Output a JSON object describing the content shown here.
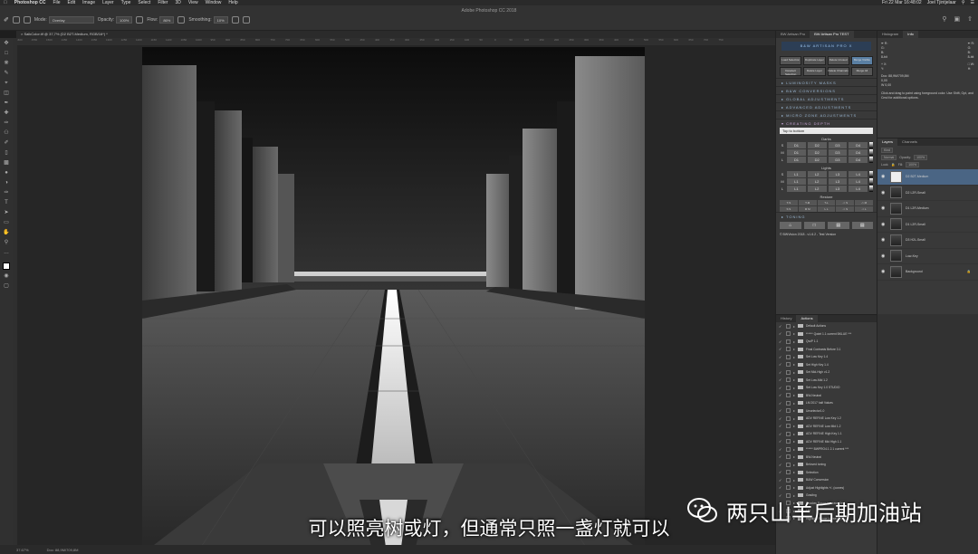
{
  "menubar": {
    "app": "Photoshop CC",
    "menus": [
      "File",
      "Edit",
      "Image",
      "Layer",
      "Type",
      "Select",
      "Filter",
      "3D",
      "View",
      "Window",
      "Help"
    ],
    "clock": "Fri 22 Mar  16:48:02",
    "user": "Joel Tjintjelaar"
  },
  "options": {
    "window_title": "Adobe Photoshop CC 2018",
    "mode_label": "Mode:",
    "mode_value": "Overlay",
    "opacity_label": "Opacity:",
    "opacity_value": "100%",
    "flow_label": "Flow:",
    "flow_value": "86%",
    "smoothing_label": "Smoothing:",
    "smoothing_value": "10%"
  },
  "document_tab": "SalkColor.tif @ 37,7% (D2 B2T-Medium, RGB/16*) *",
  "ruler_marks": [
    "1600",
    "1550",
    "1500",
    "1450",
    "1400",
    "1350",
    "1300",
    "1250",
    "1200",
    "1150",
    "1100",
    "1050",
    "1000",
    "950",
    "900",
    "850",
    "800",
    "750",
    "700",
    "650",
    "600",
    "550",
    "500",
    "450",
    "400",
    "350",
    "300",
    "250",
    "200",
    "150",
    "100",
    "50",
    "0",
    "50",
    "100",
    "150",
    "200",
    "250",
    "300",
    "350",
    "400",
    "450",
    "500",
    "550",
    "600",
    "650",
    "700",
    "750"
  ],
  "status": {
    "zoom": "37.67%",
    "doc": "Doc: 88,9M/709,8M"
  },
  "ba_panel": {
    "tab1": "BW Artisan Pro",
    "tab2": "BW Artisan Pro TEST",
    "logo": "B&W ARTISAN PRO X",
    "buttons": [
      "Load Selection",
      "Duplicate Layer",
      "Delete Unused",
      "Merge Visible",
      "Deselect Selection",
      "Delete Layer",
      "Delete Channels",
      "Merge All"
    ],
    "sections": [
      "LUMINOSITY MASKS",
      "B&W CONVERSIONS",
      "GLOBAL ADJUSTMENTS",
      "ADVANCED ADJUSTMENTS",
      "MICRO ZONE ADJUSTMENTS"
    ],
    "active_section": "CREATING DEPTH",
    "dropdown": "Top to bottom",
    "darks_title": "Darks",
    "darks_rows": [
      {
        "label": "S",
        "cells": [
          "D1",
          "D2",
          "D3",
          "D4"
        ]
      },
      {
        "label": "M",
        "cells": [
          "D1",
          "D2",
          "D3",
          "D4"
        ]
      },
      {
        "label": "L",
        "cells": [
          "D1",
          "D2",
          "D3",
          "D4"
        ]
      }
    ],
    "lights_title": "Lights",
    "lights_rows": [
      {
        "label": "S",
        "cells": [
          "L1",
          "L2",
          "L3",
          "L4"
        ]
      },
      {
        "label": "M",
        "cells": [
          "L1",
          "L2",
          "L3",
          "L4"
        ]
      },
      {
        "label": "L",
        "cells": [
          "L1",
          "L2",
          "L3",
          "L4"
        ]
      }
    ],
    "restore_title": "Restore",
    "restore_cells": [
      "T-S",
      "T-M",
      "T-L",
      "-> S",
      "-> M",
      "S S",
      "M M",
      "L L",
      "-> S",
      "-> L"
    ],
    "toning": "TONING",
    "icons": [
      "⌂",
      "□",
      "▤",
      "▤"
    ],
    "version": "© BWVision 2018 - v1.6.2 - Test Version"
  },
  "hist_panel": {
    "tab1": "Histogram",
    "tab2": "Info",
    "rgb_r": "R:",
    "rgb_g": "G:",
    "rgb_b": "B:",
    "bit1": "8-bit",
    "bit2": "8-bit",
    "doc_line": "Doc: 88,9M/709,8M",
    "inch1": "0,00",
    "inch2": "W 0,00",
    "hint": "Click and drag to paint using foreground color. Use Shift, Opt, and Cmd for additional options."
  },
  "layers_panel": {
    "tab1": "Layers",
    "tab2": "Channels",
    "kind": "Kind",
    "blend": "Normal",
    "opacity_label": "Opacity:",
    "opacity": "100%",
    "lock_label": "Lock:",
    "fill_label": "Fill:",
    "fill": "100%",
    "layers": [
      {
        "name": "D2 B2T-Medium",
        "selected": true
      },
      {
        "name": "D2 L2R-Small",
        "selected": false
      },
      {
        "name": "D1 L2R-Medium",
        "selected": false
      },
      {
        "name": "D1 L2R-Small",
        "selected": false
      },
      {
        "name": "D3 H2L-Small",
        "selected": false
      },
      {
        "name": "Low-Key",
        "selected": false
      },
      {
        "name": "Background",
        "selected": false
      }
    ]
  },
  "actions_panel": {
    "tab1": "History",
    "tab2": "Actions",
    "items": [
      "Default Actions",
      "****** Qwiet 1.1 current BKLUE ***",
      "QwiP 1.1",
      "Final Contrasts Before 3.1",
      "Set Low Key 1.4",
      "Set High Key 1.4",
      "Set Mid-High v1.2",
      "Set Low-Mid 1.2",
      "Set Low Key 1.0 STUDIO",
      "BW-Neutral",
      "LM 2017 half Values",
      "Unselector1.0",
      "ADV REFINE Low Key 1.2",
      "ADV REFINE Low Mid 1.2",
      "ADV REFINE High Key 1.1",
      "ADV REFINE Mid High 1.1",
      "****** BWPRO4.1 2.1 current ***",
      "BW-Neutral",
      "Beloved toning",
      "Selection",
      "B&W Conversion",
      "Adjust Highlights +/- (curves)",
      "Grading",
      "Shadow Range increase (lev)",
      "LM",
      "Highlight Range increase (lev)"
    ]
  },
  "subtitle": "可以照亮树或灯，但通常只照一盏灯就可以",
  "watermark": "两只山羊后期加油站"
}
